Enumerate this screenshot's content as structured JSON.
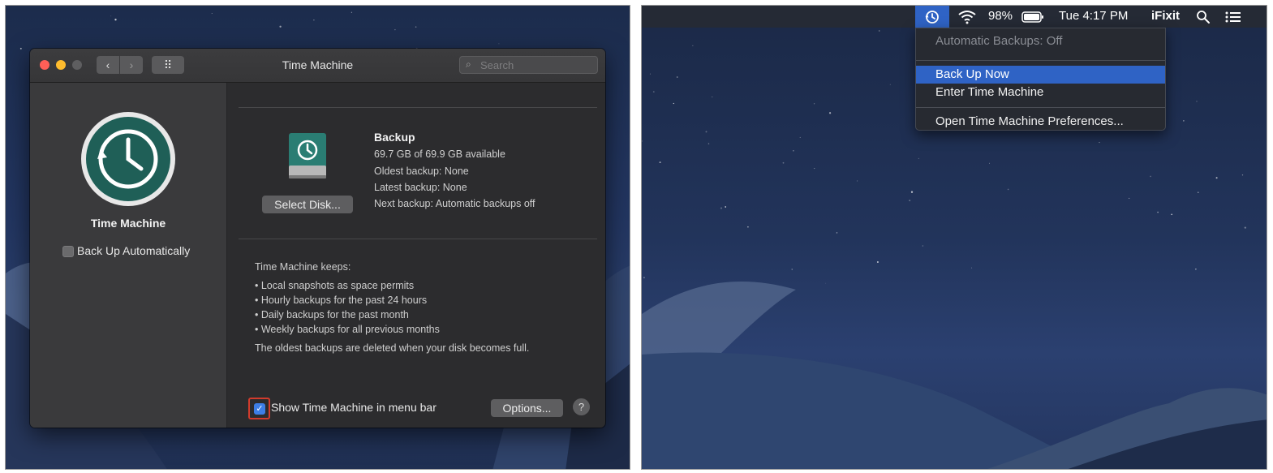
{
  "left_screenshot": {
    "window": {
      "title": "Time Machine",
      "search_placeholder": "Search",
      "nav": {
        "back": "‹",
        "forward": "›",
        "grid": "⠿"
      }
    },
    "sidebar": {
      "title": "Time Machine",
      "back_up_automatically": {
        "label": "Back Up Automatically",
        "checked": false
      }
    },
    "disk": {
      "select_disk_label": "Select Disk...",
      "name": "Backup",
      "available": "69.7 GB of 69.9 GB available",
      "oldest": "Oldest backup: None",
      "latest": "Latest backup: None",
      "next": "Next backup: Automatic backups off"
    },
    "keeps": {
      "heading": "Time Machine keeps:",
      "items": [
        "• Local snapshots as space permits",
        "• Hourly backups for the past 24 hours",
        "• Daily backups for the past month",
        "• Weekly backups for all previous months"
      ],
      "footer": "The oldest backups are deleted when your disk becomes full."
    },
    "show_in_menu_bar": {
      "label": "Show Time Machine in menu bar",
      "checked": true
    },
    "options_label": "Options...",
    "help_label": "?"
  },
  "right_screenshot": {
    "menubar": {
      "battery": "98%",
      "clock": "Tue 4:17 PM",
      "user": "iFixit",
      "icons": [
        "time-machine-icon",
        "wifi-icon",
        "battery-icon",
        "spotlight-icon",
        "notification-center-icon"
      ]
    },
    "menu": {
      "status": "Automatic Backups: Off",
      "back_up_now": "Back Up Now",
      "enter_time_machine": "Enter Time Machine",
      "open_preferences": "Open Time Machine Preferences..."
    }
  },
  "colors": {
    "highlight": "#2f63c5",
    "checkbox_checked": "#3d7ee6",
    "annotation_outline": "#d23b2c",
    "window_bg": "#2c2c2e"
  }
}
